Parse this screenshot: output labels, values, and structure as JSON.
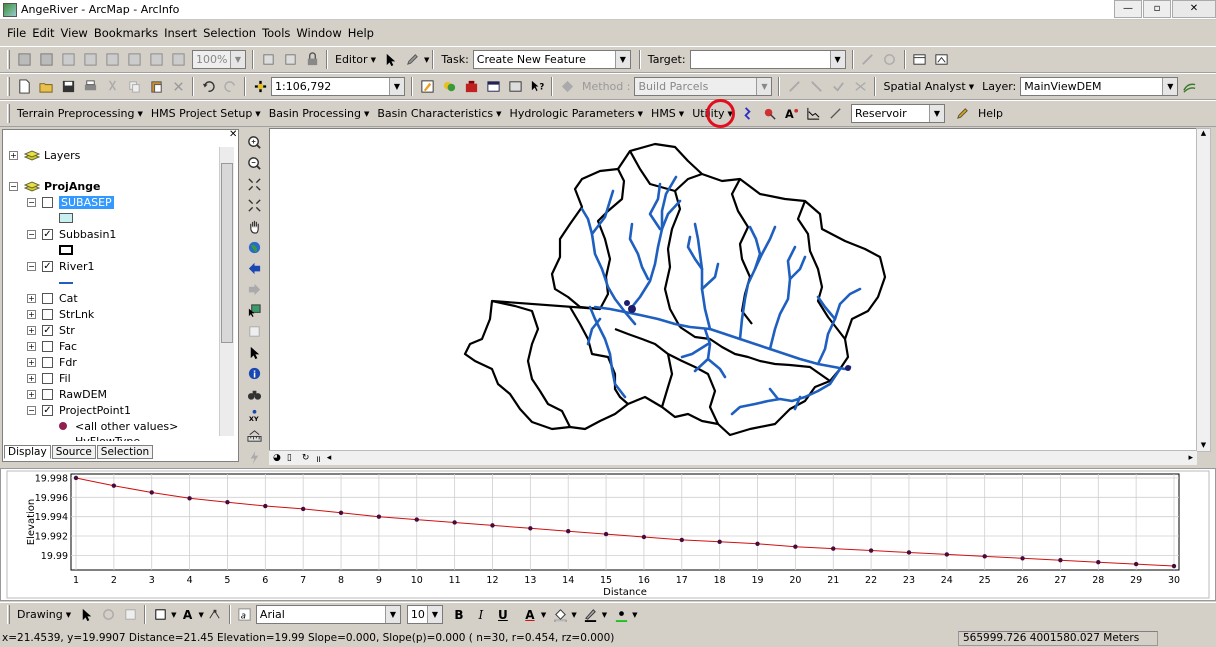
{
  "window": {
    "title": "AngeRiver - ArcMap - ArcInfo",
    "minimize": "—",
    "maximize": "▫",
    "close": "✕"
  },
  "menu": [
    "File",
    "Edit",
    "View",
    "Bookmarks",
    "Insert",
    "Selection",
    "Tools",
    "Window",
    "Help"
  ],
  "standard_toolbar": {
    "zoom": "100%",
    "editor": "Editor",
    "task_label": "Task:",
    "task_value": "Create New Feature",
    "target_label": "Target:",
    "target_value": ""
  },
  "toolbar2": {
    "scale": "1:106,792",
    "method_label": "Method :",
    "method_value": "Build Parcels",
    "spatial_analyst": "Spatial Analyst",
    "layer_label": "Layer:",
    "layer_value": "MainViewDEM"
  },
  "hec_toolbar": {
    "menus": [
      "Terrain Preprocessing",
      "HMS Project Setup",
      "Basin Processing",
      "Basin Characteristics",
      "Hydrologic Parameters",
      "HMS",
      "Utility"
    ],
    "combo_value": "Reservoir",
    "help": "Help"
  },
  "toc": {
    "root": "Layers",
    "frame": "ProjAnge",
    "layers": [
      {
        "name": "SUBASEP",
        "checked": false,
        "expanded": true,
        "selected": true
      },
      {
        "name": "Subbasin1",
        "checked": true,
        "expanded": true
      },
      {
        "name": "River1",
        "checked": true,
        "expanded": true
      },
      {
        "name": "Cat",
        "checked": false
      },
      {
        "name": "StrLnk",
        "checked": false
      },
      {
        "name": "Str",
        "checked": true
      },
      {
        "name": "Fac",
        "checked": false
      },
      {
        "name": "Fdr",
        "checked": false
      },
      {
        "name": "Fil",
        "checked": false
      },
      {
        "name": "RawDEM",
        "checked": false
      },
      {
        "name": "ProjectPoint1",
        "checked": true,
        "expanded": true
      }
    ],
    "legend_other": "<all other values>",
    "legend_cut": "HvFlowType",
    "tabs": [
      "Display",
      "Source",
      "Selection"
    ]
  },
  "chart_data": {
    "type": "line",
    "title": "",
    "xlabel": "Distance",
    "ylabel": "Elevation",
    "x": [
      1,
      2,
      3,
      4,
      5,
      6,
      7,
      8,
      9,
      10,
      11,
      12,
      13,
      14,
      15,
      16,
      17,
      18,
      19,
      20,
      21,
      22,
      23,
      24,
      25,
      26,
      27,
      28,
      29,
      30
    ],
    "y": [
      19.998,
      19.9972,
      19.9965,
      19.9959,
      19.9955,
      19.9951,
      19.9948,
      19.9944,
      19.994,
      19.9937,
      19.9934,
      19.9931,
      19.9928,
      19.9925,
      19.9922,
      19.9919,
      19.9916,
      19.9914,
      19.9912,
      19.9909,
      19.9907,
      19.9905,
      19.9903,
      19.9901,
      19.9899,
      19.9897,
      19.9895,
      19.9893,
      19.9891,
      19.9889
    ],
    "xlim": [
      1,
      30
    ],
    "ylim": [
      19.9888,
      19.9981
    ],
    "yticks": [
      19.99,
      19.992,
      19.994,
      19.996,
      19.998
    ],
    "line_color": "#d01010",
    "marker_color": "#4a0a3a"
  },
  "draw_toolbar": {
    "drawing": "Drawing",
    "font": "Arial",
    "size": "10",
    "bold": "B",
    "italic": "I",
    "underline": "U",
    "font_color_glyph": "A"
  },
  "status": {
    "left": "x=21.4539, y=19.9907 Distance=21.45 Elevation=19.99 Slope=0.000, Slope(p)=0.000 ( n=30, r=0.454, rz=0.000)",
    "right": "565999.726  4001580.027 Meters"
  },
  "colors": {
    "river": "#1e5fbf",
    "boundary": "#000000",
    "highlight": "#e01020"
  }
}
